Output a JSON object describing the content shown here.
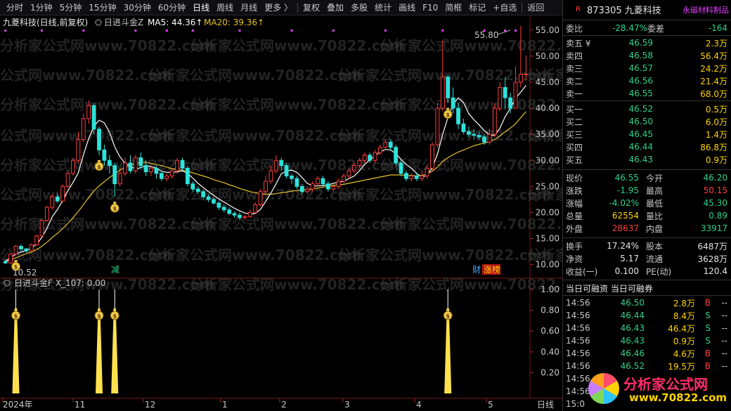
{
  "toolbar": {
    "items": [
      "分时",
      "1分钟",
      "5分钟",
      "15分钟",
      "30分钟",
      "60分钟",
      "日线",
      "周线",
      "月线",
      "更多 〉",
      "复权",
      "叠加",
      "多股",
      "统计",
      "画线",
      "F10",
      "简框",
      "标记",
      "+自选",
      "返回"
    ],
    "active_index": 6
  },
  "main_chart": {
    "title": "九菱科技(日线,前复权)",
    "indicator_name": "日进斗金Z",
    "ma5_label": "MA5: 44.36↑",
    "ma20_label": "MA20: 39.36↑",
    "high_marker": "55.80",
    "low_marker": "10.52",
    "badge_jian": "减",
    "badge_cai": "财",
    "badge_zhangbang": "涨榜",
    "y_ticks": [
      "55.00",
      "50.00",
      "45.00",
      "40.00",
      "35.00",
      "30.00",
      "25.00",
      "20.00",
      "15.00",
      "10.00"
    ],
    "y_values": [
      55,
      50,
      45,
      40,
      35,
      30,
      25,
      20,
      15,
      10
    ]
  },
  "sub_chart": {
    "title": "日进斗金F X_107: 0.00",
    "y_ticks": [
      "1.00",
      "0.80",
      "0.60",
      "0.40",
      "0.20"
    ]
  },
  "x_axis": {
    "labels": [
      "2024年",
      "11",
      "12",
      "1",
      "2",
      "3",
      "4",
      "5",
      "日线"
    ]
  },
  "chart_data": {
    "type": "candlestick",
    "ylim": [
      9,
      57
    ],
    "period": "日线",
    "candles": [
      [
        10.6,
        10.3,
        11.0,
        10.1
      ],
      [
        10.3,
        12.0,
        12.2,
        10.2
      ],
      [
        12.0,
        13.5,
        13.8,
        11.8
      ],
      [
        13.5,
        13.0,
        13.9,
        12.6
      ],
      [
        13.0,
        12.6,
        13.2,
        12.3
      ],
      [
        12.6,
        13.8,
        14.0,
        12.4
      ],
      [
        13.8,
        15.5,
        15.8,
        13.6
      ],
      [
        15.5,
        18.5,
        18.8,
        15.3
      ],
      [
        18.5,
        21.0,
        21.3,
        18.2
      ],
      [
        21.0,
        23.0,
        23.5,
        20.5
      ],
      [
        23.0,
        22.2,
        23.6,
        21.8
      ],
      [
        22.2,
        25.0,
        25.4,
        22.0
      ],
      [
        25.0,
        27.5,
        28.0,
        24.8
      ],
      [
        27.5,
        30.0,
        30.5,
        27.0
      ],
      [
        30.0,
        34.0,
        35.5,
        29.5
      ],
      [
        34.0,
        38.0,
        39.0,
        33.5
      ],
      [
        38.0,
        40.5,
        41.5,
        37.0
      ],
      [
        40.5,
        36.0,
        41.0,
        35.0
      ],
      [
        36.0,
        32.0,
        36.5,
        31.0
      ],
      [
        32.0,
        30.0,
        33.0,
        29.0
      ],
      [
        30.0,
        29.0,
        31.0,
        27.5
      ],
      [
        29.0,
        25.5,
        29.5,
        23.0
      ],
      [
        25.5,
        27.5,
        28.5,
        25.0
      ],
      [
        27.5,
        29.5,
        30.5,
        27.0
      ],
      [
        29.5,
        28.0,
        31.0,
        27.5
      ],
      [
        28.0,
        30.5,
        31.0,
        27.5
      ],
      [
        30.5,
        29.0,
        31.5,
        28.5
      ],
      [
        29.0,
        27.8,
        30.0,
        27.0
      ],
      [
        27.8,
        28.5,
        29.0,
        27.0
      ],
      [
        28.5,
        27.5,
        29.0,
        26.5
      ],
      [
        27.5,
        26.5,
        28.0,
        26.0
      ],
      [
        26.5,
        27.0,
        27.5,
        26.0
      ],
      [
        27.0,
        28.0,
        28.5,
        26.5
      ],
      [
        28.0,
        30.0,
        30.5,
        27.5
      ],
      [
        30.0,
        28.5,
        30.5,
        28.0
      ],
      [
        28.5,
        25.5,
        29.0,
        25.0
      ],
      [
        25.5,
        24.5,
        26.0,
        24.0
      ],
      [
        24.5,
        24.0,
        25.0,
        23.5
      ],
      [
        24.0,
        23.0,
        24.5,
        22.5
      ],
      [
        23.0,
        22.5,
        23.5,
        22.0
      ],
      [
        22.5,
        21.8,
        23.0,
        21.5
      ],
      [
        21.8,
        21.0,
        22.2,
        20.5
      ],
      [
        21.0,
        20.5,
        21.5,
        20.0
      ],
      [
        20.5,
        19.8,
        21.0,
        19.5
      ],
      [
        19.8,
        19.5,
        20.2,
        19.0
      ],
      [
        19.5,
        19.0,
        20.0,
        18.5
      ],
      [
        19.0,
        19.2,
        19.5,
        18.6
      ],
      [
        19.2,
        20.0,
        20.5,
        19.0
      ],
      [
        20.0,
        21.5,
        22.0,
        19.8
      ],
      [
        21.5,
        24.0,
        24.5,
        21.2
      ],
      [
        24.0,
        26.0,
        27.0,
        23.5
      ],
      [
        26.0,
        28.0,
        29.0,
        25.5
      ],
      [
        28.0,
        30.0,
        31.0,
        27.5
      ],
      [
        30.0,
        29.0,
        30.5,
        28.0
      ],
      [
        29.0,
        27.0,
        29.5,
        26.5
      ],
      [
        27.0,
        26.5,
        27.5,
        25.5
      ],
      [
        26.5,
        25.0,
        27.0,
        24.5
      ],
      [
        25.0,
        24.0,
        25.5,
        23.5
      ],
      [
        24.0,
        24.5,
        25.0,
        23.5
      ],
      [
        24.5,
        25.5,
        26.0,
        24.0
      ],
      [
        25.5,
        26.5,
        27.0,
        25.0
      ],
      [
        26.5,
        25.5,
        27.0,
        25.0
      ],
      [
        25.5,
        24.5,
        26.0,
        24.0
      ],
      [
        24.5,
        25.0,
        25.5,
        24.0
      ],
      [
        25.0,
        26.0,
        26.5,
        24.5
      ],
      [
        26.0,
        27.0,
        27.5,
        25.5
      ],
      [
        27.0,
        28.0,
        28.5,
        26.5
      ],
      [
        28.0,
        29.0,
        29.5,
        27.5
      ],
      [
        29.0,
        30.0,
        30.5,
        28.5
      ],
      [
        30.0,
        31.0,
        31.5,
        29.5
      ],
      [
        31.0,
        30.0,
        31.5,
        29.5
      ],
      [
        30.0,
        31.5,
        32.0,
        29.5
      ],
      [
        31.5,
        32.5,
        33.0,
        31.0
      ],
      [
        32.5,
        33.5,
        34.0,
        32.0
      ],
      [
        33.5,
        32.5,
        34.0,
        32.0
      ],
      [
        32.5,
        29.5,
        33.0,
        29.0
      ],
      [
        29.5,
        27.5,
        30.0,
        27.0
      ],
      [
        27.5,
        26.5,
        28.0,
        26.0
      ],
      [
        26.5,
        27.0,
        27.5,
        26.0
      ],
      [
        27.0,
        26.5,
        27.5,
        26.0
      ],
      [
        26.5,
        27.0,
        28.0,
        26.0
      ],
      [
        27.0,
        28.5,
        29.0,
        26.5
      ],
      [
        28.5,
        33.0,
        33.5,
        28.0
      ],
      [
        33.0,
        40.0,
        41.0,
        32.5
      ],
      [
        40.0,
        46.0,
        53.0,
        39.5
      ],
      [
        46.0,
        42.0,
        46.5,
        41.0
      ],
      [
        42.0,
        40.0,
        44.0,
        39.0
      ],
      [
        40.0,
        37.0,
        41.0,
        36.0
      ],
      [
        37.0,
        35.5,
        38.0,
        35.0
      ],
      [
        35.5,
        35.0,
        36.5,
        34.5
      ],
      [
        35.0,
        34.8,
        36.0,
        34.0
      ],
      [
        34.8,
        34.5,
        35.5,
        34.0
      ],
      [
        34.5,
        33.5,
        35.0,
        33.0
      ],
      [
        33.5,
        35.0,
        36.0,
        33.0
      ],
      [
        35.0,
        40.0,
        41.0,
        34.5
      ],
      [
        40.0,
        44.0,
        45.0,
        39.5
      ],
      [
        44.0,
        42.0,
        46.0,
        40.0
      ],
      [
        42.0,
        40.0,
        43.0,
        39.0
      ],
      [
        40.0,
        45.0,
        48.0,
        40.0
      ],
      [
        45.0,
        46.5,
        55.8,
        44.0
      ],
      [
        46.5,
        46.55,
        50.15,
        45.3
      ]
    ],
    "ma5": [
      10.6,
      11.3,
      12.0,
      12.4,
      12.7,
      13.2,
      13.9,
      15.2,
      17.0,
      19.2,
      20.6,
      22.3,
      24.2,
      25.8,
      27.6,
      31.1,
      34.2,
      36.5,
      37.7,
      37.2,
      35.4,
      32.6,
      30.7,
      29.4,
      28.9,
      28.3,
      28.6,
      29.0,
      28.8,
      28.5,
      27.9,
      27.7,
      27.7,
      27.8,
      28.0,
      27.5,
      26.6,
      25.6,
      24.8,
      24.0,
      23.3,
      22.6,
      22.0,
      21.4,
      20.8,
      20.3,
      19.9,
      19.7,
      19.8,
      20.6,
      22.1,
      23.7,
      25.5,
      27.4,
      28.0,
      28.1,
      27.7,
      26.7,
      25.6,
      25.1,
      25.1,
      25.2,
      25.3,
      25.6,
      25.8,
      26.0,
      26.5,
      27.0,
      28.0,
      29.2,
      30.1,
      30.9,
      31.6,
      32.1,
      32.0,
      31.3,
      30.2,
      29.2,
      28.5,
      27.5,
      26.8,
      27.1,
      28.6,
      31.2,
      35.0,
      38.2,
      40.8,
      42.0,
      41.1,
      39.0,
      37.8,
      36.8,
      35.7,
      34.9,
      34.8,
      36.2,
      38.4,
      40.0,
      41.9,
      43.1,
      44.36
    ],
    "ma20": [
      10.6,
      10.9,
      11.3,
      11.7,
      12.1,
      12.4,
      12.9,
      13.5,
      14.3,
      15.2,
      16.0,
      16.9,
      17.9,
      19.0,
      20.2,
      21.5,
      22.9,
      24.1,
      25.1,
      25.9,
      26.7,
      27.4,
      28.1,
      28.7,
      29.1,
      29.4,
      29.6,
      29.6,
      29.4,
      29.2,
      29.0,
      28.7,
      28.4,
      28.3,
      28.1,
      27.9,
      27.6,
      27.3,
      27.0,
      26.7,
      26.3,
      26.0,
      25.7,
      25.3,
      25.0,
      24.6,
      24.3,
      24.0,
      23.8,
      23.6,
      23.5,
      23.5,
      23.6,
      23.8,
      23.9,
      24.1,
      24.2,
      24.3,
      24.4,
      24.5,
      24.7,
      24.9,
      25.0,
      25.2,
      25.3,
      25.4,
      25.6,
      25.8,
      26.0,
      26.2,
      26.4,
      26.6,
      26.8,
      27.0,
      27.2,
      27.2,
      27.2,
      27.1,
      27.1,
      27.0,
      27.1,
      27.4,
      27.9,
      28.7,
      29.8,
      30.5,
      31.1,
      31.6,
      32.0,
      32.4,
      32.8,
      33.1,
      33.3,
      33.6,
      34.0,
      34.7,
      35.5,
      36.2,
      37.0,
      38.2,
      39.36
    ],
    "signals": [
      2,
      18,
      21,
      85
    ],
    "signal_values": [
      1,
      1,
      1,
      1
    ]
  },
  "quote": {
    "code_name": "873305 九菱科技",
    "sector": "永磁材料制品",
    "r_badge": "R",
    "weibi_label": "委比",
    "weibi_value": "-28.47%",
    "weicha_label": "委差",
    "weicha_value": "-164",
    "asks": [
      {
        "label": "卖五 ¥",
        "price": "46.59",
        "vol": "2.3万"
      },
      {
        "label": "卖四",
        "price": "46.58",
        "vol": "56.4万"
      },
      {
        "label": "卖三",
        "price": "46.57",
        "vol": "24.2万"
      },
      {
        "label": "卖二",
        "price": "46.56",
        "vol": "21.4万"
      },
      {
        "label": "卖一",
        "price": "46.55",
        "vol": "68.0万"
      }
    ],
    "bids": [
      {
        "label": "买一",
        "price": "46.52",
        "vol": "0.5万"
      },
      {
        "label": "买二",
        "price": "46.50",
        "vol": "6.0万"
      },
      {
        "label": "买三",
        "price": "46.45",
        "vol": "1.4万"
      },
      {
        "label": "买四",
        "price": "46.44",
        "vol": "86.8万"
      },
      {
        "label": "买五",
        "price": "46.43",
        "vol": "0.9万"
      }
    ],
    "stats": [
      {
        "l1": "现价",
        "v1": "46.55",
        "c1": "grn",
        "l2": "今开",
        "v2": "46.20",
        "c2": "grn"
      },
      {
        "l1": "涨跌",
        "v1": "-1.95",
        "c1": "grn",
        "l2": "最高",
        "v2": "50.15",
        "c2": "red"
      },
      {
        "l1": "涨幅",
        "v1": "-4.02%",
        "c1": "grn",
        "l2": "最低",
        "v2": "45.30",
        "c2": "grn"
      },
      {
        "l1": "总量",
        "v1": "62554",
        "c1": "yel",
        "l2": "量比",
        "v2": "0.89",
        "c2": "grn"
      },
      {
        "l1": "外盘",
        "v1": "28637",
        "c1": "red",
        "l2": "内盘",
        "v2": "33917",
        "c2": "grn"
      }
    ],
    "fund": [
      {
        "l1": "换手",
        "v1": "17.24%",
        "l2": "股本",
        "v2": "6487万"
      },
      {
        "l1": "净资",
        "v1": "5.17",
        "l2": "流通",
        "v2": "3628万"
      },
      {
        "l1": "收益(一)",
        "v1": "0.100",
        "l2": "PE(动)",
        "v2": "120.4"
      }
    ],
    "margin_label": "当日可融资 当日可融券",
    "ticks": [
      {
        "time": "14:56",
        "price": "46.50",
        "vol": "2.8万",
        "side": "B",
        "ex": "--"
      },
      {
        "time": "14:56",
        "price": "46.44",
        "vol": "8.4万",
        "side": "S",
        "ex": "--"
      },
      {
        "time": "14:56",
        "price": "46.43",
        "vol": "46.4万",
        "side": "S",
        "ex": "--"
      },
      {
        "time": "14:56",
        "price": "46.43",
        "vol": "0.9万",
        "side": "S",
        "ex": "--"
      },
      {
        "time": "14:56",
        "price": "46.46",
        "vol": "4.6万",
        "side": "B",
        "ex": "--"
      },
      {
        "time": "14:56",
        "price": "46.52",
        "vol": "19.5万",
        "side": "B",
        "ex": "--"
      },
      {
        "time": "14:56",
        "price": "",
        "vol": "",
        "side": "",
        "ex": ""
      },
      {
        "time": "14:56",
        "price": "",
        "vol": "",
        "side": "",
        "ex": ""
      },
      {
        "time": "15:0",
        "price": "",
        "vol": "",
        "side": "",
        "ex": ""
      }
    ]
  },
  "watermark": {
    "text": "分析家公式网www.70822.com",
    "logo_text": "分析家公式网",
    "logo_url": "www.70822.com"
  }
}
